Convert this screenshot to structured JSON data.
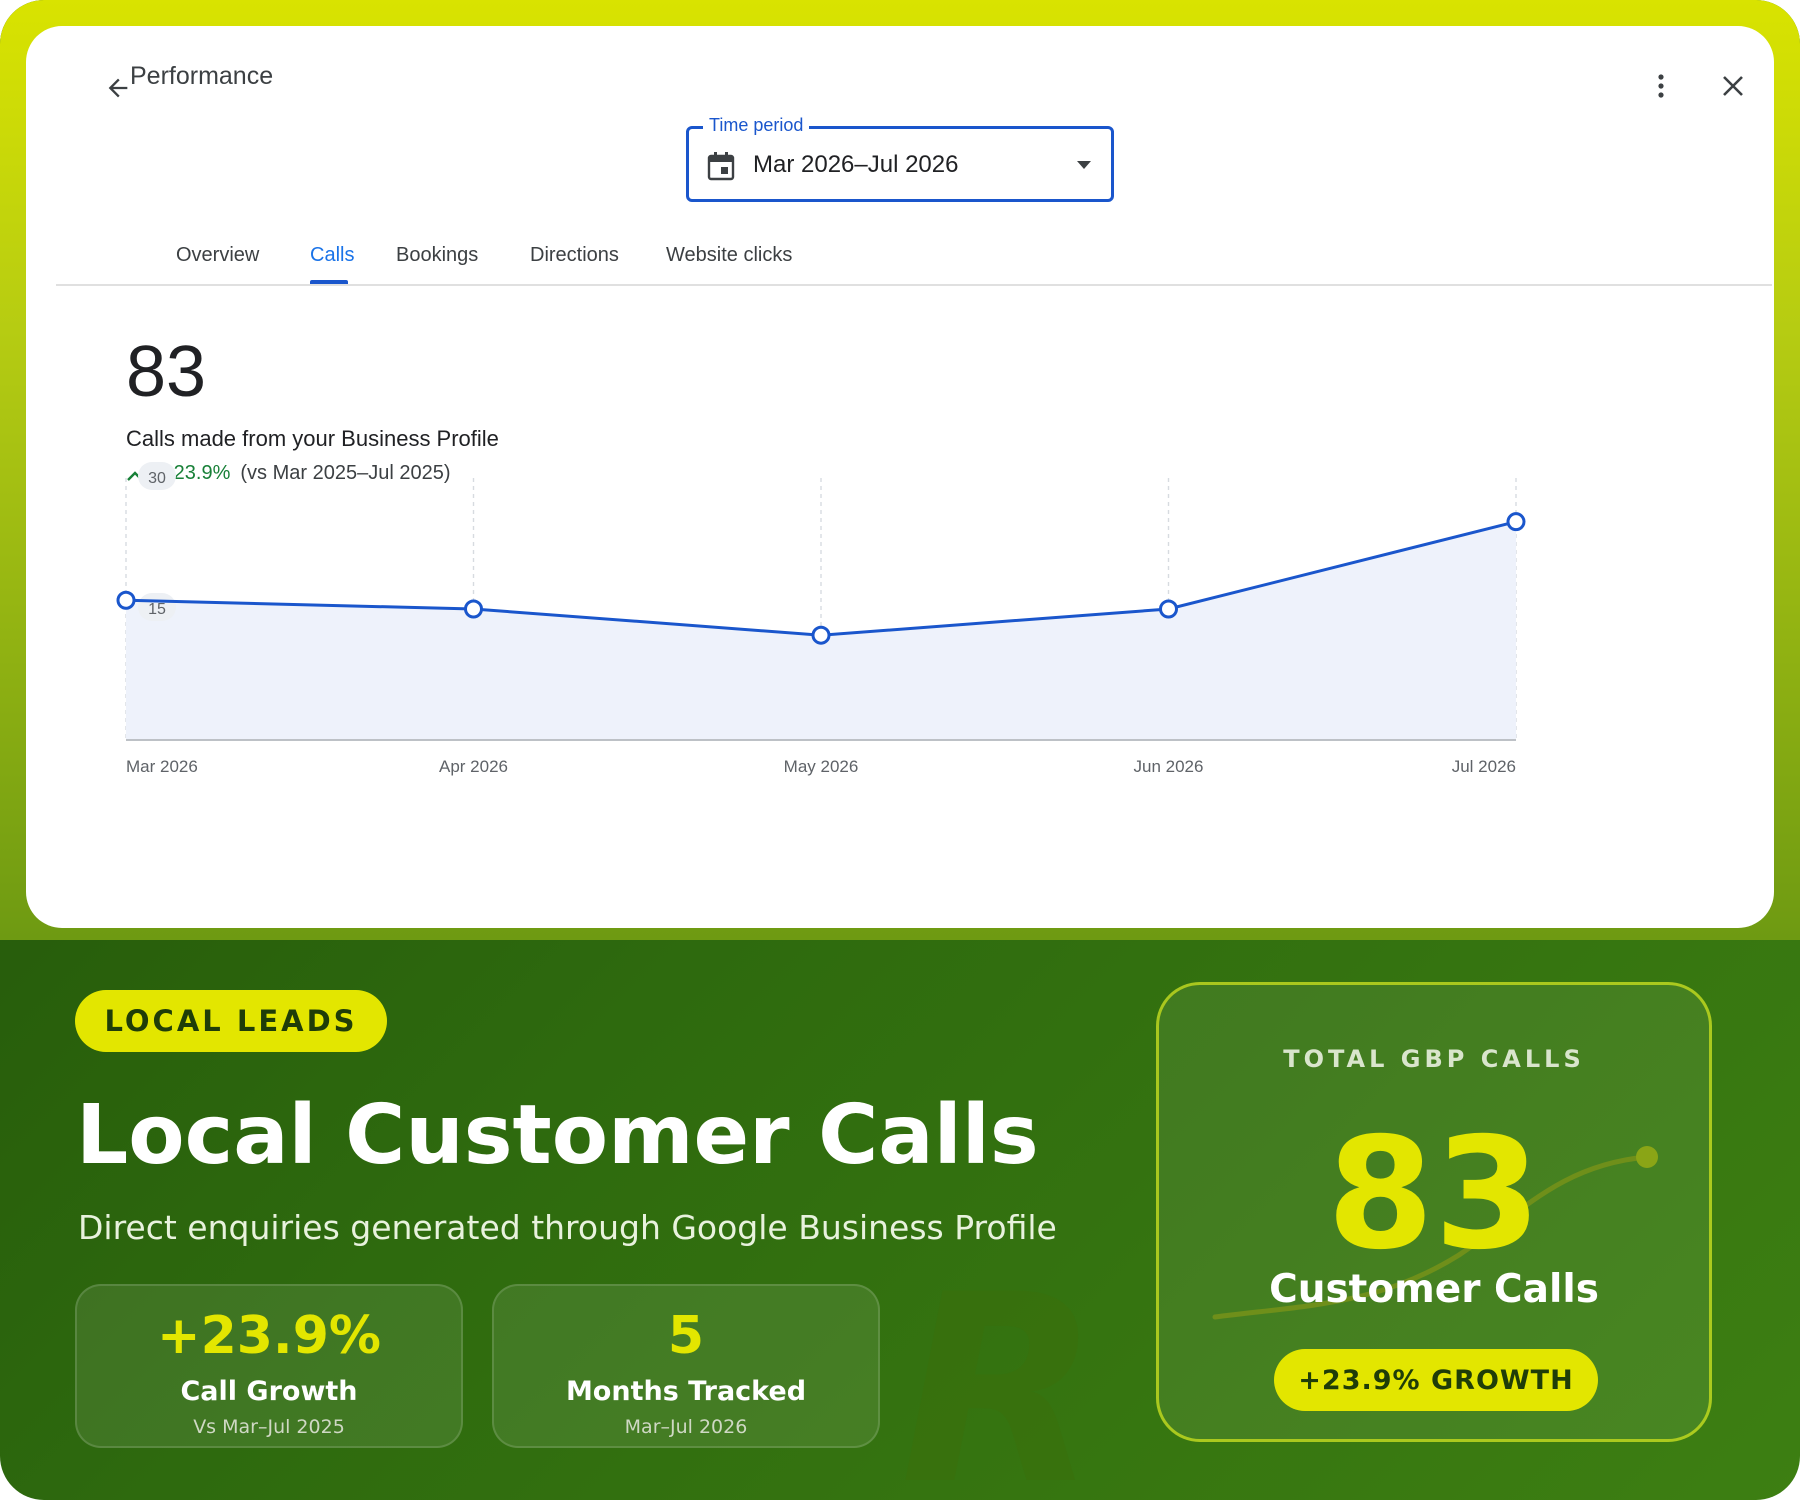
{
  "header": {
    "title": "Performance"
  },
  "time_period": {
    "label": "Time period",
    "value": "Mar 2026–Jul 2026"
  },
  "tabs": [
    {
      "label": "Overview",
      "active": false
    },
    {
      "label": "Calls",
      "active": true
    },
    {
      "label": "Bookings",
      "active": false
    },
    {
      "label": "Directions",
      "active": false
    },
    {
      "label": "Website clicks",
      "active": false
    }
  ],
  "summary": {
    "total": "83",
    "label": "Calls made from your Business Profile",
    "change": "+23.9%",
    "comparison": "(vs Mar 2025–Jul 2025)"
  },
  "chart_data": {
    "type": "line",
    "categories": [
      "Mar 2026",
      "Apr 2026",
      "May 2026",
      "Jun 2026",
      "Jul 2026"
    ],
    "values": [
      16,
      15,
      12,
      15,
      25
    ],
    "y_ticks": [
      "30",
      "15"
    ],
    "ylim": [
      0,
      30
    ],
    "grid": "vertical-dashed",
    "color": "#1a56cc"
  },
  "promo": {
    "badge": "LOCAL LEADS",
    "headline": "Local Customer Calls",
    "subhead": "Direct enquiries generated through Google Business Profile",
    "stats": [
      {
        "value": "+23.9%",
        "name": "Call Growth",
        "note": "Vs Mar–Jul 2025"
      },
      {
        "value": "5",
        "name": "Months Tracked",
        "note": "Mar–Jul 2026"
      }
    ],
    "watermark": "R",
    "total_card": {
      "title": "TOTAL GBP CALLS",
      "number": "83",
      "label": "Customer Calls",
      "pill": "+23.9% GROWTH"
    },
    "colors": {
      "accent": "#e3e600",
      "dark_green": "#1f4d08"
    }
  }
}
